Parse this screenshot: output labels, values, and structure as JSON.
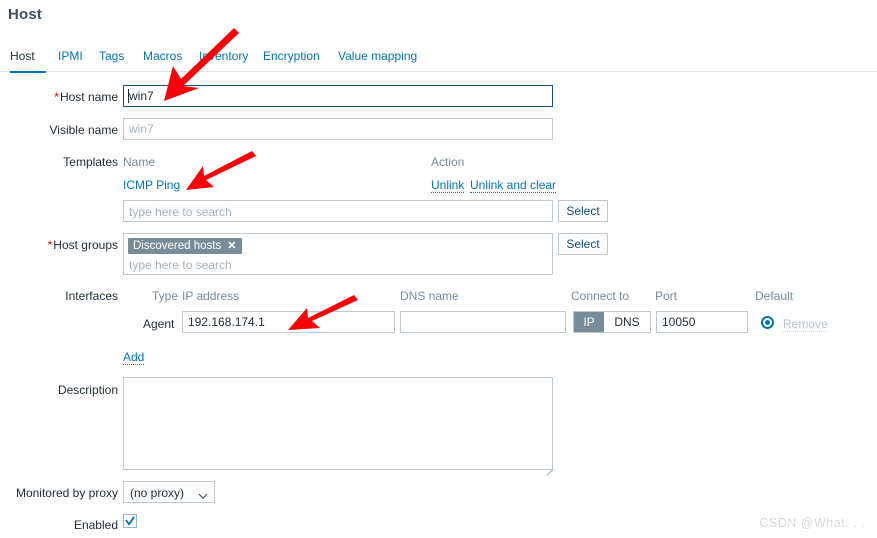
{
  "header": {
    "title": "Host"
  },
  "tabs": [
    {
      "label": "Host",
      "active": true
    },
    {
      "label": "IPMI",
      "active": false
    },
    {
      "label": "Tags",
      "active": false
    },
    {
      "label": "Macros",
      "active": false
    },
    {
      "label": "Inventory",
      "active": false
    },
    {
      "label": "Encryption",
      "active": false
    },
    {
      "label": "Value mapping",
      "active": false
    }
  ],
  "form": {
    "host_name": {
      "label": "Host name",
      "required": true,
      "value": "win7"
    },
    "visible_name": {
      "label": "Visible name",
      "required": false,
      "value": "",
      "placeholder": "win7"
    },
    "templates": {
      "label": "Templates",
      "col_name": "Name",
      "col_action": "Action",
      "rows": [
        {
          "name": "ICMP Ping",
          "unlink": "Unlink",
          "unlink_and_clear": "Unlink and clear"
        }
      ],
      "search_placeholder": "type here to search",
      "select_button": "Select"
    },
    "host_groups": {
      "label": "Host groups",
      "required": true,
      "chips": [
        "Discovered hosts"
      ],
      "chip_remove_icon": "close-icon",
      "search_placeholder": "type here to search",
      "select_button": "Select"
    },
    "interfaces": {
      "label": "Interfaces",
      "columns": {
        "type": "Type",
        "ip_address": "IP address",
        "dns_name": "DNS name",
        "connect_to": "Connect to",
        "port": "Port",
        "default": "Default"
      },
      "rows": [
        {
          "type": "Agent",
          "ip_address": "192.168.174.1",
          "dns_name": "",
          "connect_to_options": [
            "IP",
            "DNS"
          ],
          "connect_to_selected": "IP",
          "port": "10050",
          "default_selected": true,
          "remove_label": "Remove"
        }
      ],
      "add_link": "Add"
    },
    "description": {
      "label": "Description",
      "value": ""
    },
    "monitored_by_proxy": {
      "label": "Monitored by proxy",
      "selected": "(no proxy)",
      "options": [
        "(no proxy)"
      ],
      "chevron_icon": "chevron-down-icon"
    },
    "enabled": {
      "label": "Enabled",
      "checked": true,
      "check_icon": "check-icon"
    }
  },
  "annotations": {
    "arrow_color": "#fb0007",
    "arrows": [
      {
        "name": "arrow-host-name-field"
      },
      {
        "name": "arrow-icmp-ping-template"
      },
      {
        "name": "arrow-ip-address-field"
      }
    ]
  },
  "watermark": {
    "text": "CSDN @What. . ."
  }
}
